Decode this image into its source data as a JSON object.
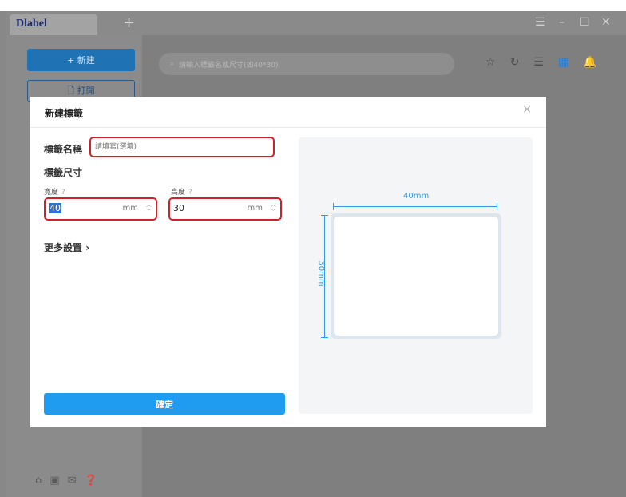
{
  "app": {
    "logo": "label",
    "tab_add": "+",
    "window_controls": {
      "menu": "☰",
      "minimize": "–",
      "maximize": "☐",
      "close": "✕"
    }
  },
  "sidebar": {
    "new_label": "+ 新建",
    "open_label": "🗋 打開",
    "bottom_icons": [
      "home-icon",
      "video-icon",
      "mail-icon",
      "help-icon"
    ]
  },
  "search": {
    "placeholder": "請輸入標籤名或尺寸(如40*30)",
    "icon": "search-icon"
  },
  "toolbar": {
    "icons": [
      "star-icon",
      "refresh-icon",
      "list-view-icon",
      "grid-view-icon",
      "bell-icon"
    ],
    "accent": "#2b7fd6"
  },
  "dialog": {
    "title": "新建標籤",
    "close_glyph": "×",
    "name_label": "標籤名稱",
    "name_placeholder": "請填寫(選填)",
    "size_title": "標籤尺寸",
    "width_label": "寬度",
    "height_label": "高度",
    "help_glyph": "?",
    "width_value": "40",
    "height_value": "30",
    "unit": "mm",
    "more_settings": "更多設置",
    "confirm": "確定",
    "highlight_color": "#d0202a",
    "button_color": "#1f9cf0"
  },
  "preview": {
    "width_label": "40mm",
    "height_label": "30mm",
    "dimension_color": "#2f9be8"
  }
}
